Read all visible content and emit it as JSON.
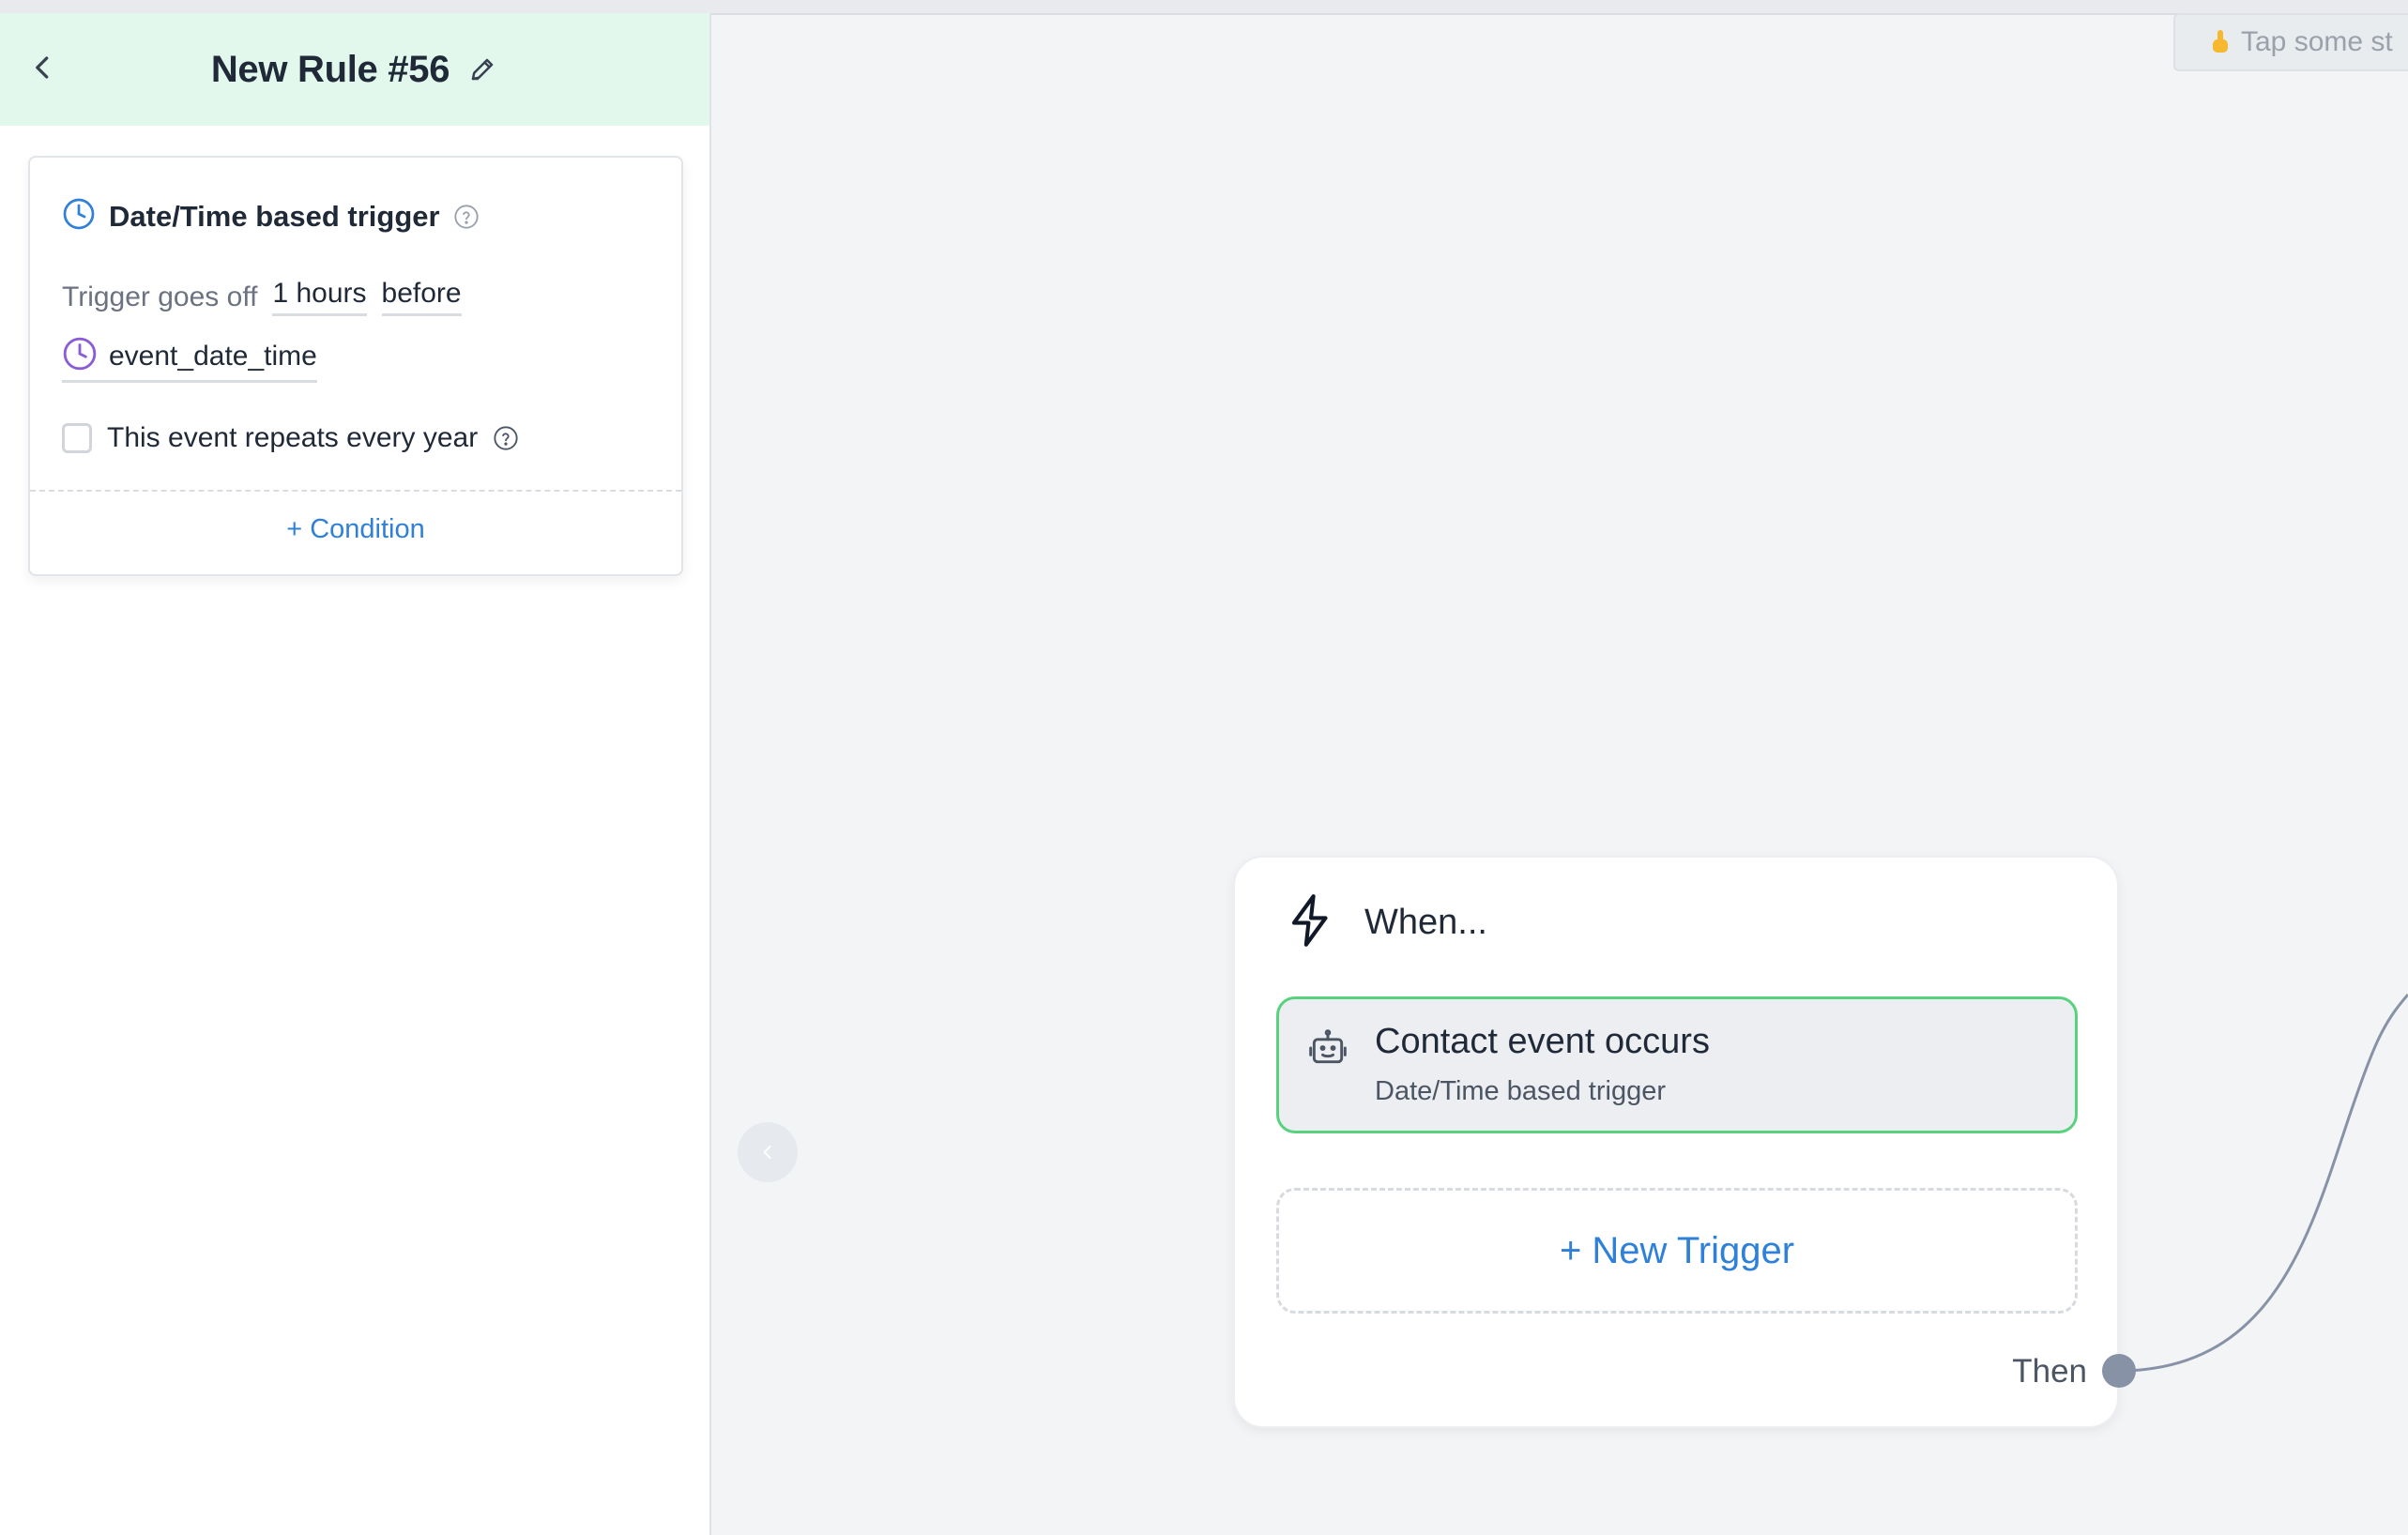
{
  "sidebar": {
    "title": "New Rule #56",
    "trigger_card": {
      "title": "Date/Time based trigger",
      "trigger_label": "Trigger goes off",
      "offset_value": "1 hours",
      "offset_direction": "before",
      "date_field": "event_date_time",
      "repeat_label": "This event repeats every year",
      "repeat_checked": false,
      "condition_button": "+ Condition"
    }
  },
  "canvas": {
    "tip": "Tap some st",
    "when_card": {
      "title": "When...",
      "event_title": "Contact event occurs",
      "event_subtitle": "Date/Time based trigger",
      "new_trigger_button": "+ New Trigger",
      "then_label": "Then"
    }
  },
  "colors": {
    "header_bg": "#e3f8ec",
    "accent_blue": "#2f80d8",
    "selected_border": "#58d27e",
    "date_icon_purple": "#8a5cd6",
    "connector": "#8792a6"
  },
  "icons": [
    "back-icon",
    "pencil-icon",
    "clock-icon",
    "help-icon",
    "lightning-icon",
    "robot-icon",
    "pointing-hand-icon",
    "chevron-left-icon"
  ]
}
